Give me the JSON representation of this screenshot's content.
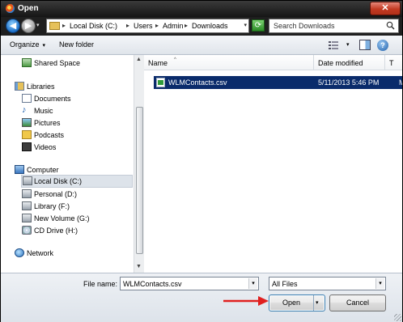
{
  "window": {
    "title": "Open",
    "close_label": "✕"
  },
  "nav": {
    "back_glyph": "◀",
    "forward_glyph": "▶",
    "dropdown_glyph": "▾"
  },
  "address": {
    "segments": [
      "Local Disk (C:)",
      "Users",
      "Admin",
      "Downloads"
    ],
    "separator": "▸",
    "refresh_glyph": "⟳"
  },
  "search": {
    "placeholder": "Search Downloads"
  },
  "toolbar": {
    "organize_label": "Organize",
    "organize_caret": "▾",
    "new_folder_label": "New folder",
    "views_caret": "▾",
    "help_label": "?"
  },
  "sidebar": {
    "items": [
      {
        "label": "Shared Space",
        "icon": "shared-space-icon"
      },
      {
        "label": "Libraries",
        "icon": "libraries-icon"
      },
      {
        "label": "Documents",
        "icon": "documents-icon"
      },
      {
        "label": "Music",
        "icon": "music-icon"
      },
      {
        "label": "Pictures",
        "icon": "pictures-icon"
      },
      {
        "label": "Podcasts",
        "icon": "podcasts-icon"
      },
      {
        "label": "Videos",
        "icon": "videos-icon"
      },
      {
        "label": "Computer",
        "icon": "computer-icon"
      },
      {
        "label": "Local Disk (C:)",
        "icon": "drive-icon",
        "selected": true
      },
      {
        "label": "Personal (D:)",
        "icon": "drive-icon"
      },
      {
        "label": "Library (F:)",
        "icon": "drive-icon"
      },
      {
        "label": "New Volume (G:)",
        "icon": "drive-icon"
      },
      {
        "label": "CD Drive (H:)",
        "icon": "cd-drive-icon"
      },
      {
        "label": "Network",
        "icon": "network-icon"
      }
    ],
    "music_glyph": "♪"
  },
  "columns": {
    "name": "Name",
    "date_modified": "Date modified",
    "type": "T",
    "sort_glyph": "^"
  },
  "files": [
    {
      "name": "WLMContacts.csv",
      "date_modified": "5/11/2013 5:46 PM",
      "type": "M",
      "selected": true
    }
  ],
  "bottom": {
    "file_name_label": "File name:",
    "file_name_value": "WLMContacts.csv",
    "filter_value": "All Files",
    "open_label": "Open",
    "cancel_label": "Cancel",
    "caret": "▾"
  },
  "colors": {
    "selection": "#0a2b6b",
    "annotation_arrow": "#e02020",
    "titlebar": "#1f1f1f"
  }
}
